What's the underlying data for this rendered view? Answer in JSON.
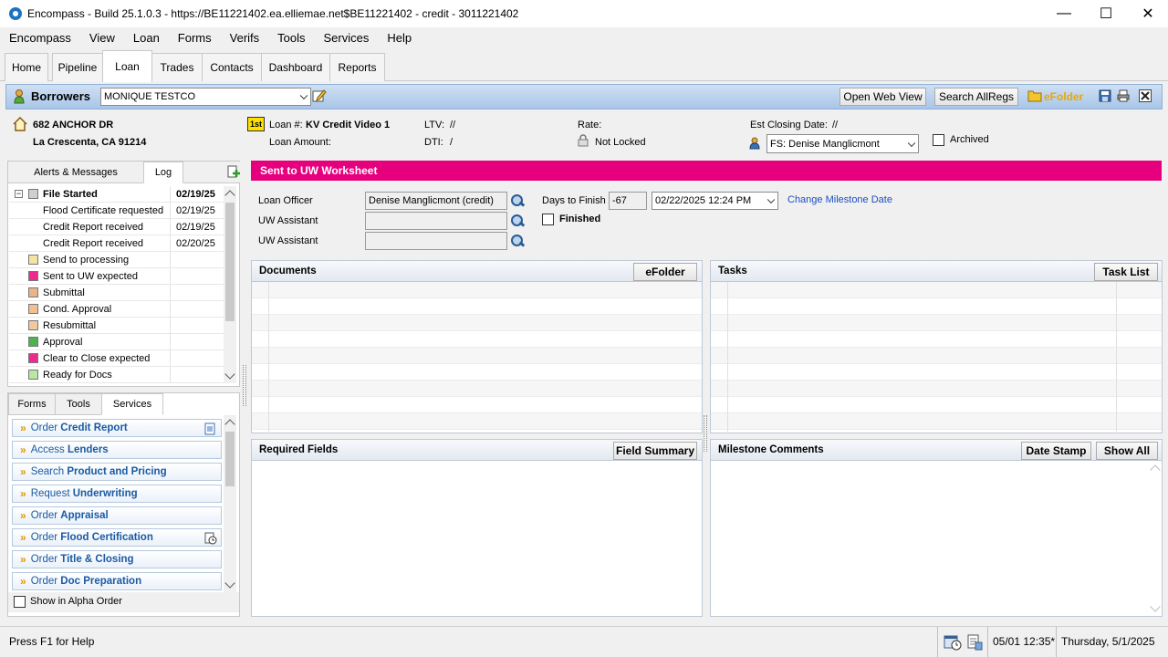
{
  "window": {
    "title": "Encompass - Build 25.1.0.3 - https://BE11221402.ea.elliemae.net$BE11221402 - credit - 3011221402",
    "controls": {
      "minimize": "—",
      "maximize": "☐",
      "close": "✕"
    }
  },
  "menu": [
    "Encompass",
    "View",
    "Loan",
    "Forms",
    "Verifs",
    "Tools",
    "Services",
    "Help"
  ],
  "tabs": [
    "Home",
    "Pipeline",
    "Loan",
    "Trades",
    "Contacts",
    "Dashboard",
    "Reports"
  ],
  "active_tab": "Loan",
  "borrower_bar": {
    "label": "Borrowers",
    "selected_borrower": "MONIQUE TESTCO",
    "open_web_view": "Open Web View",
    "search_allregs": "Search AllRegs",
    "efolder": "eFolder"
  },
  "loan_info": {
    "address_line1": "682 ANCHOR DR",
    "address_line2": "La Crescenta, CA 91214",
    "lien_badge": "1st",
    "loan_num_label": "Loan #:",
    "loan_num": "KV Credit Video 1",
    "loan_amount_label": "Loan Amount:",
    "ltv_label": "LTV:",
    "ltv_value": "//",
    "dti_label": "DTI:",
    "dti_value": "/",
    "rate_label": "Rate:",
    "lock_status": "Not Locked",
    "est_closing_label": "Est Closing Date:",
    "est_closing_value": "//",
    "contact": "FS: Denise Manglicmont",
    "archived_label": "Archived"
  },
  "log_panel": {
    "tabs": [
      "Alerts & Messages",
      "Log"
    ],
    "active_tab": "Log",
    "rows": [
      {
        "label": "File Started",
        "date": "02/19/25",
        "bold": true,
        "color": "#cfcfcf"
      },
      {
        "label": "Flood Certificate requested",
        "date": "02/19/25",
        "bold": false,
        "color": ""
      },
      {
        "label": "Credit Report received",
        "date": "02/19/25",
        "bold": false,
        "color": ""
      },
      {
        "label": "Credit Report received",
        "date": "02/20/25",
        "bold": false,
        "color": ""
      },
      {
        "label": "Send to processing",
        "date": "",
        "bold": false,
        "color": "#f4e3a3"
      },
      {
        "label": "Sent to UW expected",
        "date": "",
        "bold": false,
        "color": "#ef2a8f"
      },
      {
        "label": "Submittal",
        "date": "",
        "bold": false,
        "color": "#e9b48a"
      },
      {
        "label": "Cond. Approval",
        "date": "",
        "bold": false,
        "color": "#f0c08e"
      },
      {
        "label": "Resubmittal",
        "date": "",
        "bold": false,
        "color": "#f2c8a0"
      },
      {
        "label": "Approval",
        "date": "",
        "bold": false,
        "color": "#4fb24f"
      },
      {
        "label": "Clear to Close expected",
        "date": "",
        "bold": false,
        "color": "#ef2a8f"
      },
      {
        "label": "Ready for Docs",
        "date": "",
        "bold": false,
        "color": "#b9e6a3"
      }
    ]
  },
  "services_panel": {
    "tabs": [
      "Forms",
      "Tools",
      "Services"
    ],
    "active_tab": "Services",
    "items": [
      {
        "prefix": "Order ",
        "bold": "Credit Report",
        "icon": "document-icon"
      },
      {
        "prefix": "Access ",
        "bold": "Lenders",
        "icon": ""
      },
      {
        "prefix": "Search ",
        "bold": "Product and Pricing",
        "icon": ""
      },
      {
        "prefix": "Request ",
        "bold": "Underwriting",
        "icon": ""
      },
      {
        "prefix": "Order ",
        "bold": "Appraisal",
        "icon": ""
      },
      {
        "prefix": "Order ",
        "bold": "Flood Certification",
        "icon": "clock-document-icon"
      },
      {
        "prefix": "Order ",
        "bold": "Title & Closing",
        "icon": ""
      },
      {
        "prefix": "Order ",
        "bold": "Doc Preparation",
        "icon": ""
      }
    ],
    "alpha_order_label": "Show in Alpha Order"
  },
  "worksheet": {
    "title": "Sent to UW Worksheet",
    "loan_officer_label": "Loan Officer",
    "loan_officer_value": "Denise Manglicmont (credit)",
    "uw_assistant_label_1": "UW Assistant",
    "uw_assistant_label_2": "UW Assistant",
    "days_to_finish_label": "Days to Finish",
    "days_to_finish_value": "-67",
    "milestone_date": "02/22/2025 12:24 PM",
    "change_milestone_link": "Change Milestone Date",
    "finished_label": "Finished",
    "documents_label": "Documents",
    "efolder_button": "eFolder",
    "tasks_label": "Tasks",
    "task_list_button": "Task List",
    "required_fields_label": "Required Fields",
    "field_summary_button": "Field Summary",
    "milestone_comments_label": "Milestone Comments",
    "date_stamp_button": "Date Stamp",
    "show_all_button": "Show All"
  },
  "status_bar": {
    "help_text": "Press F1 for Help",
    "time": "05/01 12:35*",
    "date": "Thursday, 5/1/2025"
  }
}
